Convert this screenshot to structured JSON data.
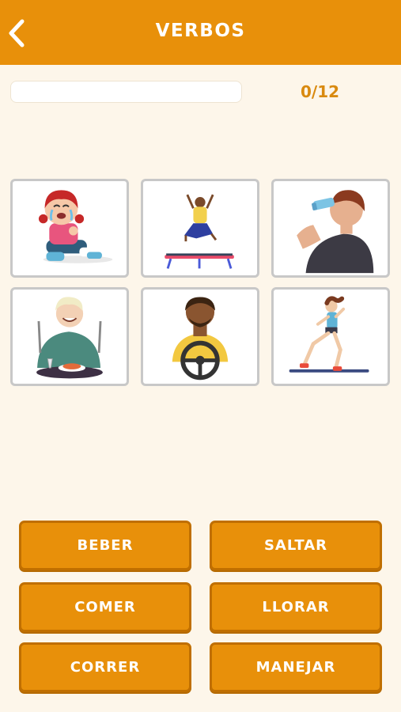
{
  "header": {
    "title": "VERBOS",
    "back_icon": "chevron-left-icon"
  },
  "progress": {
    "label": "0/12",
    "value": 0
  },
  "cards": [
    {
      "name": "card-crying-girl",
      "icon": "crying-girl-illustration"
    },
    {
      "name": "card-jumping-trampoline",
      "icon": "jumping-person-illustration"
    },
    {
      "name": "card-drinking-man",
      "icon": "drinking-man-illustration"
    },
    {
      "name": "card-eating-man",
      "icon": "eating-man-illustration"
    },
    {
      "name": "card-driving-man",
      "icon": "driving-man-illustration"
    },
    {
      "name": "card-running-woman",
      "icon": "running-woman-illustration"
    }
  ],
  "answers": [
    "BEBER",
    "SALTAR",
    "COMER",
    "LLORAR",
    "CORRER",
    "MANEJAR"
  ],
  "colors": {
    "accent": "#e8900a",
    "background": "#fdf6ea",
    "card_border": "#c8c8c8"
  }
}
